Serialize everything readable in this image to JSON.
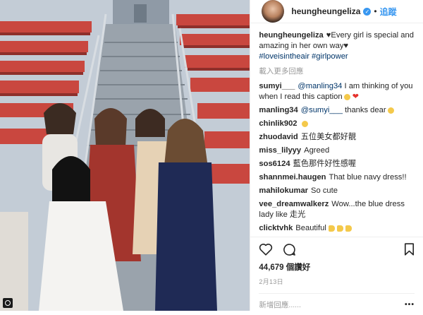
{
  "header": {
    "username": "heungheungeliza",
    "verified_mark": "✓",
    "follow_label": "追蹤",
    "separator": "•"
  },
  "caption": {
    "username": "heungheungeliza",
    "text": "♥Every girl is special and amazing in her own way♥",
    "hashtags": [
      "#loveisintheair",
      "#girlpower"
    ]
  },
  "load_more_label": "載入更多回應",
  "comments": [
    {
      "user": "sumyi___",
      "mention": "@manling34",
      "text": " I am thinking of you when I read this caption",
      "emoji": "smile+heart"
    },
    {
      "user": "manling34",
      "mention": "@sumyi___",
      "text": " thanks dear",
      "emoji": "smile"
    },
    {
      "user": "chinlik902",
      "mention": "",
      "text": "",
      "emoji": "smile"
    },
    {
      "user": "zhuodavid",
      "mention": "",
      "text": "五位美女都好靚",
      "emoji": ""
    },
    {
      "user": "miss_lilyyy",
      "mention": "",
      "text": "Agreed",
      "emoji": ""
    },
    {
      "user": "sos6124",
      "mention": "",
      "text": "藍色那件好性感喔",
      "emoji": ""
    },
    {
      "user": "shannmei.haugen",
      "mention": "",
      "text": "That blue navy dress!!",
      "emoji": ""
    },
    {
      "user": "mahilokumar",
      "mention": "",
      "text": "So cute",
      "emoji": ""
    },
    {
      "user": "vee_dreamwalkerz",
      "mention": "",
      "text": "Wow...the blue dress lady like 走光",
      "emoji": ""
    },
    {
      "user": "clicktvhk",
      "mention": "",
      "text": "Beautiful",
      "emoji": "thumbs"
    }
  ],
  "likes": "44,679 個讚好",
  "date": "2月13日",
  "add_comment_placeholder": "新增回應......",
  "more_label": "•••",
  "icons": {
    "like": "heart-outline-icon",
    "comment": "speech-bubble-icon",
    "save": "bookmark-icon",
    "photo_corner": "camera-icon"
  },
  "colors": {
    "link": "#003569",
    "accent": "#3897f0",
    "muted": "#999999",
    "text": "#262626"
  }
}
